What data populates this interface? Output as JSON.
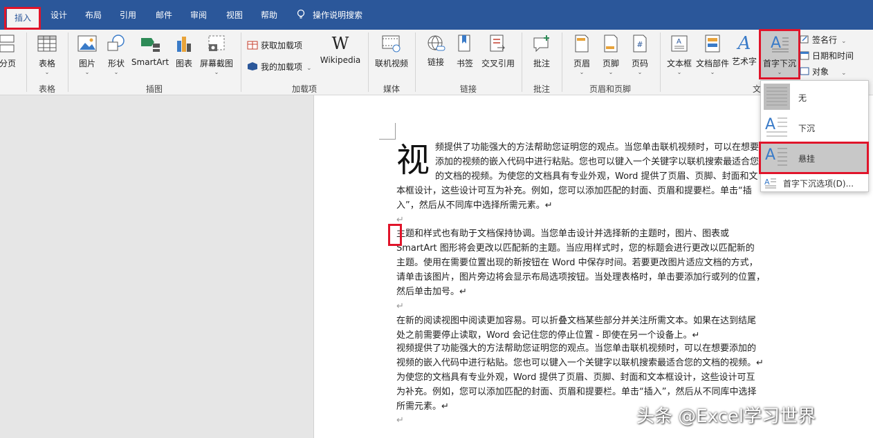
{
  "tabs": [
    {
      "label": "插入",
      "active": true
    },
    {
      "label": "设计"
    },
    {
      "label": "布局"
    },
    {
      "label": "引用"
    },
    {
      "label": "邮件"
    },
    {
      "label": "审阅"
    },
    {
      "label": "视图"
    },
    {
      "label": "帮助"
    }
  ],
  "search": {
    "label": "操作说明搜索",
    "icon": "lightbulb-icon"
  },
  "ribbon": {
    "page_break": "分页",
    "table": "表格",
    "pictures": "图片",
    "shapes": "形状",
    "smartart": "SmartArt",
    "chart": "图表",
    "screenshot": "屏幕截图",
    "get_addins": "获取加载项",
    "my_addins": "我的加载项",
    "wikipedia": "Wikipedia",
    "online_video": "联机视频",
    "link": "链接",
    "bookmark": "书签",
    "crossref": "交叉引用",
    "comment": "批注",
    "header": "页眉",
    "footer": "页脚",
    "page_number": "页码",
    "textbox": "文本框",
    "quickparts": "文档部件",
    "wordart": "艺术字",
    "dropcap": "首字下沉",
    "signature": "签名行",
    "datetime": "日期和时间",
    "object": "对象",
    "groups": {
      "tables": "表格",
      "illustrations": "插图",
      "addins": "加载项",
      "media": "媒体",
      "links": "链接",
      "comments": "批注",
      "headerfooter": "页眉和页脚",
      "text": "文"
    }
  },
  "dropdown": {
    "none": "无",
    "dropped": "下沉",
    "margin": "悬挂",
    "options": "首字下沉选项(D)..."
  },
  "document": {
    "dropcap_char": "视",
    "p1": [
      "频提供了功能强大的方法帮助您证明您的观点。当您单击联机视频时，可以在想要",
      "添加的视频的嵌入代码中进行粘贴。您也可以键入一个关键字以联机搜索最适合您",
      "的文档的视频。为使您的文档具有专业外观，Word 提供了页眉、页脚、封面和文",
      "本框设计，这些设计可互为补充。例如，您可以添加匹配的封面、页眉和提要栏。单击“插",
      "入”，然后从不同库中选择所需元素。↵"
    ],
    "blank1": "↵",
    "p2": [
      "主题和样式也有助于文档保持协调。当您单击设计并选择新的主题时，图片、图表或",
      "SmartArt 图形将会更改以匹配新的主题。当应用样式时，您的标题会进行更改以匹配新的",
      "主题。使用在需要位置出现的新按钮在 Word 中保存时间。若要更改图片适应文档的方式，",
      "请单击该图片，图片旁边将会显示布局选项按钮。当处理表格时，单击要添加行或列的位置，",
      "然后单击加号。↵"
    ],
    "blank2": "↵",
    "p3": [
      "在新的阅读视图中阅读更加容易。可以折叠文档某些部分并关注所需文本。如果在达到结尾",
      "处之前需要停止读取，Word 会记住您的停止位置 - 即使在另一个设备上。↵",
      "视频提供了功能强大的方法帮助您证明您的观点。当您单击联机视频时，可以在想要添加的",
      "视频的嵌入代码中进行粘贴。您也可以键入一个关键字以联机搜索最适合您的文档的视频。↵",
      "为使您的文档具有专业外观，Word 提供了页眉、页脚、封面和文本框设计，这些设计可互",
      "为补充。例如，您可以添加匹配的封面、页眉和提要栏。单击“插入”，然后从不同库中选择",
      "所需元素。↵"
    ],
    "blank3": "↵"
  },
  "watermark": "头条 @Excel学习世界",
  "colors": {
    "accent": "#2b579a",
    "highlight": "#e0142a"
  }
}
